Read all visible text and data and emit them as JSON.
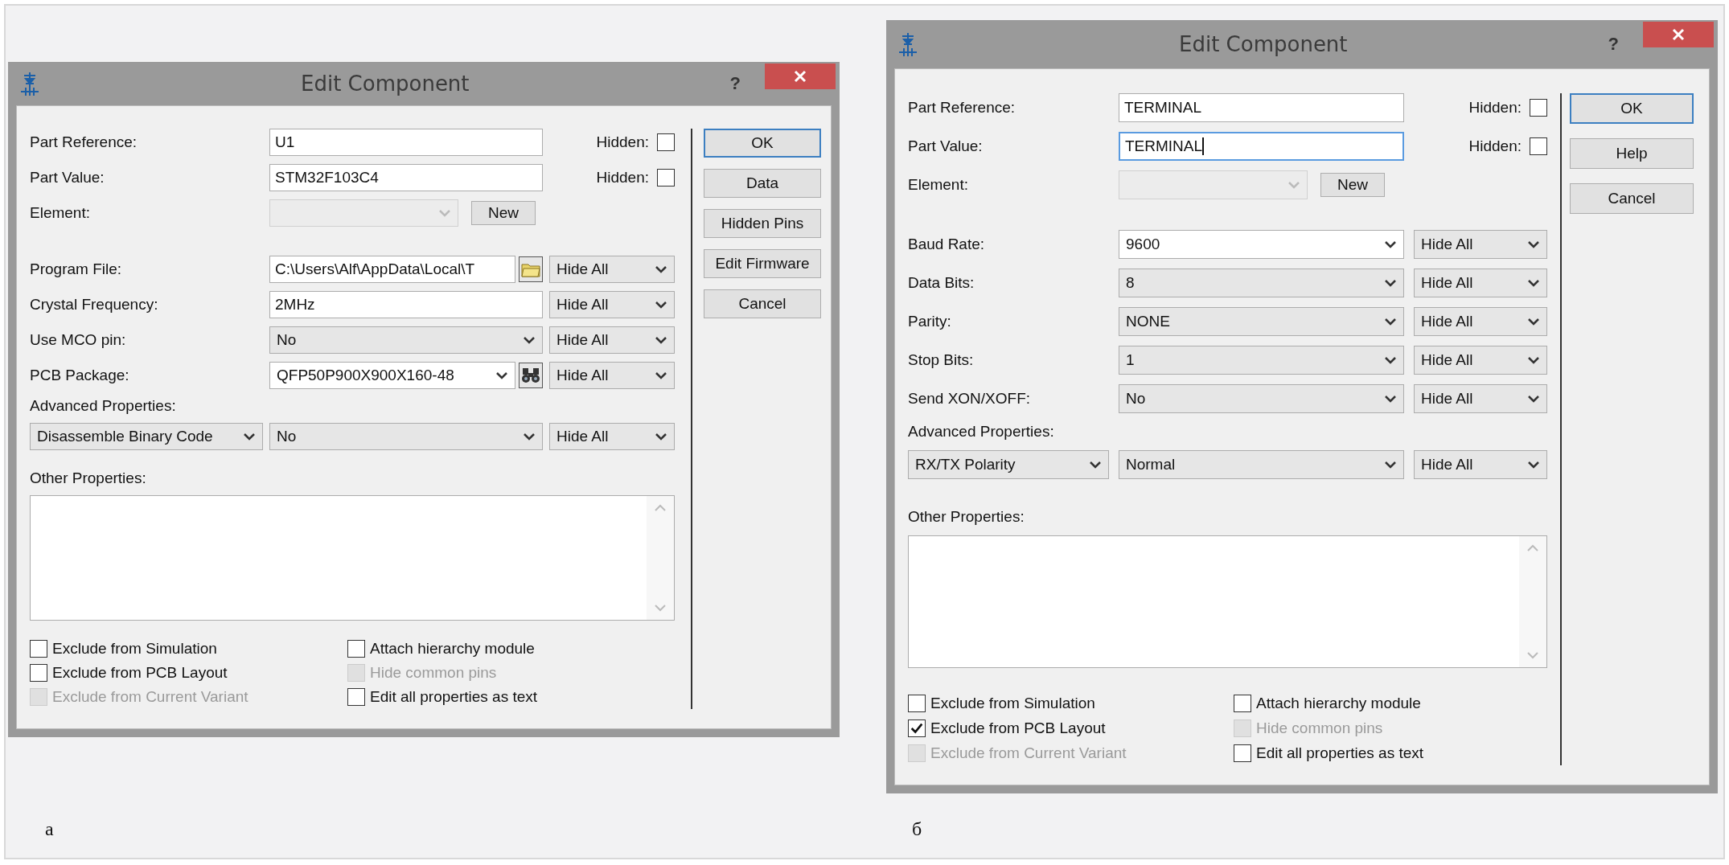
{
  "panels": [
    {
      "caption": "а",
      "dialog": {
        "title": "Edit Component",
        "help": "?",
        "part_rows": [
          {
            "label": "Part Reference:",
            "value": "U1",
            "hidden_label": "Hidden:",
            "hidden": false,
            "focused": false
          },
          {
            "label": "Part Value:",
            "value": "STM32F103C4",
            "hidden_label": "Hidden:",
            "hidden": false,
            "focused": false
          }
        ],
        "element": {
          "label": "Element:",
          "button": "New"
        },
        "properties": [
          {
            "kind": "file",
            "label": "Program File:",
            "value": "C:\\Users\\Alf\\AppData\\Local\\T",
            "visibility": "Hide All"
          },
          {
            "kind": "text",
            "label": "Crystal Frequency:",
            "value": "2MHz",
            "visibility": "Hide All"
          },
          {
            "kind": "select",
            "label": "Use MCO pin:",
            "value": "No",
            "visibility": "Hide All"
          },
          {
            "kind": "package",
            "label": "PCB Package:",
            "value": "QFP50P900X900X160-48",
            "visibility": "Hide All"
          }
        ],
        "advanced": {
          "label": "Advanced Properties:",
          "property": "Disassemble Binary Code",
          "value": "No",
          "visibility": "Hide All"
        },
        "other": {
          "label": "Other Properties:"
        },
        "checkboxes": [
          {
            "label": "Exclude from Simulation",
            "checked": false,
            "disabled": false
          },
          {
            "label": "Attach hierarchy module",
            "checked": false,
            "disabled": false
          },
          {
            "label": "Exclude from PCB Layout",
            "checked": false,
            "disabled": false
          },
          {
            "label": "Hide common pins",
            "checked": false,
            "disabled": true
          },
          {
            "label": "Exclude from Current Variant",
            "checked": false,
            "disabled": true
          },
          {
            "label": "Edit all properties as text",
            "checked": false,
            "disabled": false
          }
        ],
        "buttons": [
          {
            "label": "OK",
            "default": true
          },
          {
            "label": "Data",
            "default": false
          },
          {
            "label": "Hidden Pins",
            "default": false
          },
          {
            "label": "Edit Firmware",
            "default": false
          },
          {
            "label": "Cancel",
            "default": false
          }
        ]
      }
    },
    {
      "caption": "б",
      "dialog": {
        "title": "Edit Component",
        "help": "?",
        "part_rows": [
          {
            "label": "Part Reference:",
            "value": "TERMINAL",
            "hidden_label": "Hidden:",
            "hidden": false,
            "focused": false
          },
          {
            "label": "Part Value:",
            "value": "TERMINAL",
            "hidden_label": "Hidden:",
            "hidden": false,
            "focused": true
          }
        ],
        "element": {
          "label": "Element:",
          "button": "New"
        },
        "properties": [
          {
            "kind": "combo",
            "label": "Baud Rate:",
            "value": "9600",
            "visibility": "Hide All"
          },
          {
            "kind": "select",
            "label": "Data Bits:",
            "value": "8",
            "visibility": "Hide All"
          },
          {
            "kind": "select",
            "label": "Parity:",
            "value": "NONE",
            "visibility": "Hide All"
          },
          {
            "kind": "select",
            "label": "Stop Bits:",
            "value": "1",
            "visibility": "Hide All"
          },
          {
            "kind": "select",
            "label": "Send XON/XOFF:",
            "value": "No",
            "visibility": "Hide All"
          }
        ],
        "advanced": {
          "label": "Advanced Properties:",
          "property": "RX/TX Polarity",
          "value": "Normal",
          "visibility": "Hide All"
        },
        "other": {
          "label": "Other Properties:"
        },
        "checkboxes": [
          {
            "label": "Exclude from Simulation",
            "checked": false,
            "disabled": false
          },
          {
            "label": "Attach hierarchy module",
            "checked": false,
            "disabled": false
          },
          {
            "label": "Exclude from PCB Layout",
            "checked": true,
            "disabled": false
          },
          {
            "label": "Hide common pins",
            "checked": false,
            "disabled": true
          },
          {
            "label": "Exclude from Current Variant",
            "checked": false,
            "disabled": true
          },
          {
            "label": "Edit all properties as text",
            "checked": false,
            "disabled": false
          }
        ],
        "buttons": [
          {
            "label": "OK",
            "default": true
          },
          {
            "label": "Help",
            "default": false
          },
          {
            "label": "Cancel",
            "default": false
          }
        ]
      }
    }
  ]
}
